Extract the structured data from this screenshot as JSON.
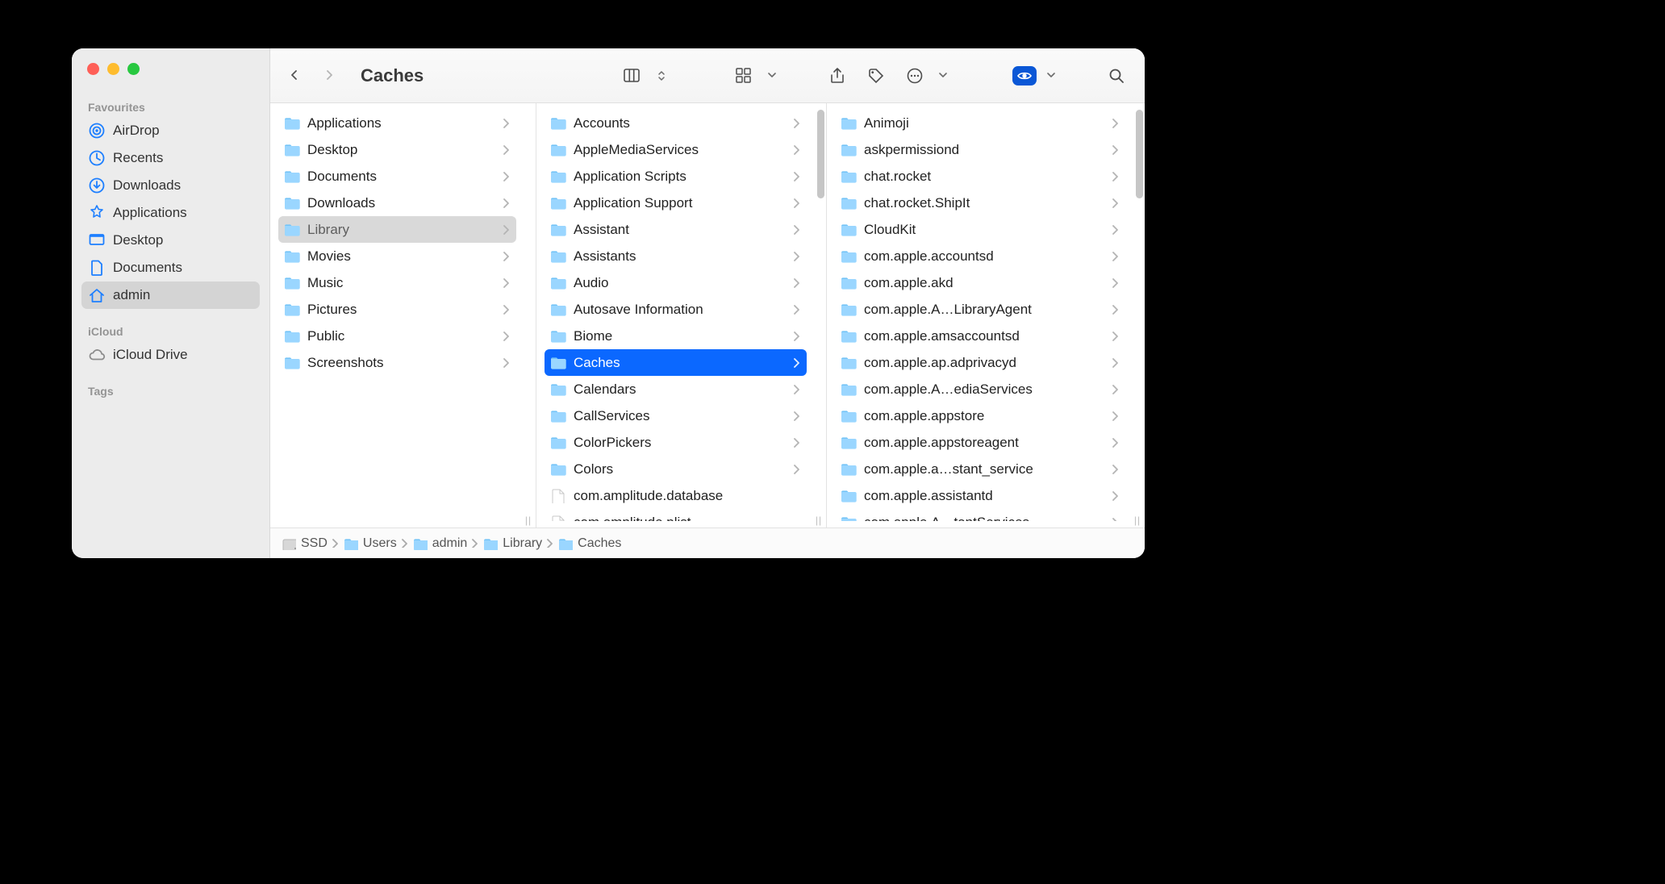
{
  "window": {
    "title": "Caches"
  },
  "sidebar": {
    "sections": [
      {
        "label": "Favourites",
        "items": [
          {
            "icon": "airdrop",
            "label": "AirDrop",
            "selected": false
          },
          {
            "icon": "clock",
            "label": "Recents",
            "selected": false
          },
          {
            "icon": "download",
            "label": "Downloads",
            "selected": false
          },
          {
            "icon": "apps",
            "label": "Applications",
            "selected": false
          },
          {
            "icon": "desktop",
            "label": "Desktop",
            "selected": false
          },
          {
            "icon": "document",
            "label": "Documents",
            "selected": false
          },
          {
            "icon": "house",
            "label": "admin",
            "selected": true
          }
        ]
      },
      {
        "label": "iCloud",
        "items": [
          {
            "icon": "cloud",
            "label": "iCloud Drive",
            "selected": false
          }
        ]
      },
      {
        "label": "Tags",
        "items": []
      }
    ]
  },
  "columns": [
    {
      "items": [
        {
          "type": "folder",
          "name": "Applications",
          "state": ""
        },
        {
          "type": "folder",
          "name": "Desktop",
          "state": ""
        },
        {
          "type": "folder",
          "name": "Documents",
          "state": ""
        },
        {
          "type": "folder",
          "name": "Downloads",
          "state": ""
        },
        {
          "type": "folder",
          "name": "Library",
          "state": "path-selected"
        },
        {
          "type": "folder",
          "name": "Movies",
          "state": ""
        },
        {
          "type": "folder",
          "name": "Music",
          "state": ""
        },
        {
          "type": "folder",
          "name": "Pictures",
          "state": ""
        },
        {
          "type": "folder",
          "name": "Public",
          "state": ""
        },
        {
          "type": "folder",
          "name": "Screenshots",
          "state": ""
        }
      ]
    },
    {
      "items": [
        {
          "type": "folder",
          "name": "Accounts",
          "state": ""
        },
        {
          "type": "folder",
          "name": "AppleMediaServices",
          "state": ""
        },
        {
          "type": "folder",
          "name": "Application Scripts",
          "state": ""
        },
        {
          "type": "folder",
          "name": "Application Support",
          "state": ""
        },
        {
          "type": "folder",
          "name": "Assistant",
          "state": ""
        },
        {
          "type": "folder",
          "name": "Assistants",
          "state": ""
        },
        {
          "type": "folder",
          "name": "Audio",
          "state": ""
        },
        {
          "type": "folder",
          "name": "Autosave Information",
          "state": ""
        },
        {
          "type": "folder",
          "name": "Biome",
          "state": ""
        },
        {
          "type": "folder",
          "name": "Caches",
          "state": "active"
        },
        {
          "type": "folder",
          "name": "Calendars",
          "state": ""
        },
        {
          "type": "folder",
          "name": "CallServices",
          "state": ""
        },
        {
          "type": "folder",
          "name": "ColorPickers",
          "state": ""
        },
        {
          "type": "folder",
          "name": "Colors",
          "state": ""
        },
        {
          "type": "file",
          "name": "com.amplitude.database",
          "state": ""
        },
        {
          "type": "file",
          "name": "com.amplitude.plist",
          "state": ""
        }
      ]
    },
    {
      "items": [
        {
          "type": "folder",
          "name": "Animoji",
          "state": ""
        },
        {
          "type": "folder",
          "name": "askpermissiond",
          "state": ""
        },
        {
          "type": "folder",
          "name": "chat.rocket",
          "state": ""
        },
        {
          "type": "folder",
          "name": "chat.rocket.ShipIt",
          "state": ""
        },
        {
          "type": "folder",
          "name": "CloudKit",
          "state": ""
        },
        {
          "type": "folder",
          "name": "com.apple.accountsd",
          "state": ""
        },
        {
          "type": "folder",
          "name": "com.apple.akd",
          "state": ""
        },
        {
          "type": "folder",
          "name": "com.apple.A…LibraryAgent",
          "state": ""
        },
        {
          "type": "folder",
          "name": "com.apple.amsaccountsd",
          "state": ""
        },
        {
          "type": "folder",
          "name": "com.apple.ap.adprivacyd",
          "state": ""
        },
        {
          "type": "folder",
          "name": "com.apple.A…ediaServices",
          "state": ""
        },
        {
          "type": "folder",
          "name": "com.apple.appstore",
          "state": ""
        },
        {
          "type": "folder",
          "name": "com.apple.appstoreagent",
          "state": ""
        },
        {
          "type": "folder",
          "name": "com.apple.a…stant_service",
          "state": ""
        },
        {
          "type": "folder",
          "name": "com.apple.assistantd",
          "state": ""
        },
        {
          "type": "folder",
          "name": "com.apple.A…tantServices",
          "state": ""
        }
      ]
    }
  ],
  "pathbar": [
    {
      "icon": "disk",
      "label": "SSD"
    },
    {
      "icon": "folder",
      "label": "Users"
    },
    {
      "icon": "folder",
      "label": "admin"
    },
    {
      "icon": "folder",
      "label": "Library"
    },
    {
      "icon": "folder",
      "label": "Caches"
    }
  ],
  "colors": {
    "accent": "#0b68ff",
    "folder_light": "#8fd0ff",
    "folder_dark": "#5eb8f5"
  }
}
